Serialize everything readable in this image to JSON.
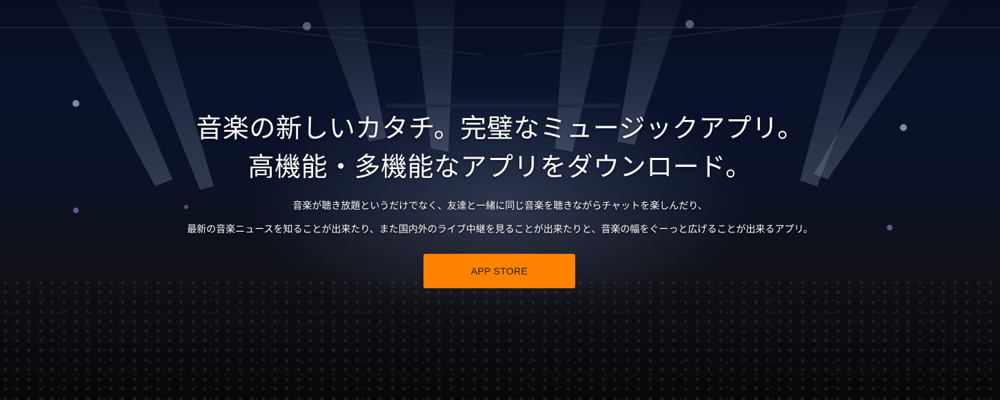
{
  "hero": {
    "headline_line1": "音楽の新しいカタチ。完璧なミュージックアプリ。",
    "headline_line2": "高機能・多機能なアプリをダウンロード。",
    "description_line1": "音楽が聴き放題というだけでなく、友達と一緒に同じ音楽を聴きながらチャットを楽しんだり、",
    "description_line2": "最新の音楽ニュースを知ることが出来たり、また国内外のライブ中継を見ることが出来たりと、音楽の幅をぐーっと広げることが出来るアプリ。",
    "cta_label": "APP STORE"
  },
  "colors": {
    "cta_background": "#ff8200",
    "cta_text": "#1a1a1a",
    "text": "#ffffff"
  }
}
